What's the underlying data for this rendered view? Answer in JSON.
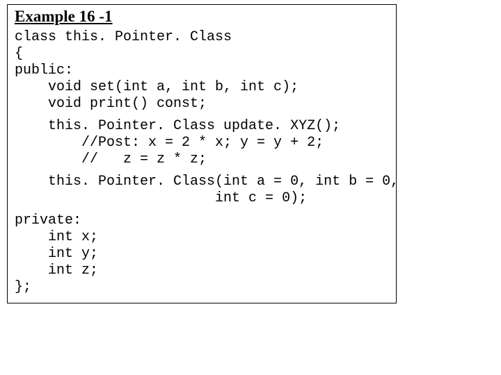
{
  "title": "Example 16 -1",
  "code": {
    "l1": "class this. Pointer. Class",
    "l2": "{",
    "l3": "public:",
    "l4": "    void set(int a, int b, int c);",
    "l5": "    void print() const;",
    "l6": "    this. Pointer. Class update. XYZ();",
    "l7": "        //Post: x = 2 * x; y = y + 2;",
    "l8": "        //   z = z * z;",
    "l9": "    this. Pointer. Class(int a = 0, int b = 0,",
    "l10": "                        int c = 0);",
    "l11": "private:",
    "l12": "    int x;",
    "l13": "    int y;",
    "l14": "    int z;",
    "l15": "};"
  }
}
